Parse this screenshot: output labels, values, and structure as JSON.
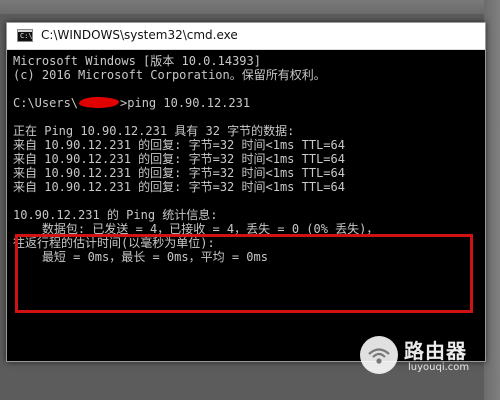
{
  "window": {
    "title": "C:\\WINDOWS\\system32\\cmd.exe",
    "icon": "cmd-icon",
    "icon_text": "C:\\"
  },
  "console": {
    "lines": [
      "Microsoft Windows [版本 10.0.14393]",
      "(c) 2016 Microsoft Corporation。保留所有权利。",
      "",
      {
        "prefix": "C:\\Users\\",
        "suffix": ">ping 10.90.12.231"
      },
      "",
      "正在 Ping 10.90.12.231 具有 32 字节的数据:",
      "来自 10.90.12.231 的回复: 字节=32 时间<1ms TTL=64",
      "来自 10.90.12.231 的回复: 字节=32 时间<1ms TTL=64",
      "来自 10.90.12.231 的回复: 字节=32 时间<1ms TTL=64",
      "来自 10.90.12.231 的回复: 字节=32 时间<1ms TTL=64",
      "",
      "10.90.12.231 的 Ping 统计信息:",
      "    数据包: 已发送 = 4，已接收 = 4，丢失 = 0 (0% 丢失)，",
      "往返行程的估计时间(以毫秒为单位):",
      "    最短 = 0ms，最长 = 0ms，平均 = 0ms"
    ]
  },
  "annotation": {
    "color": "#d11212",
    "redaction_color": "#e10000"
  },
  "watermark": {
    "name": "路由器",
    "url": "luyouqi.com",
    "icon": "router-logo-icon"
  }
}
